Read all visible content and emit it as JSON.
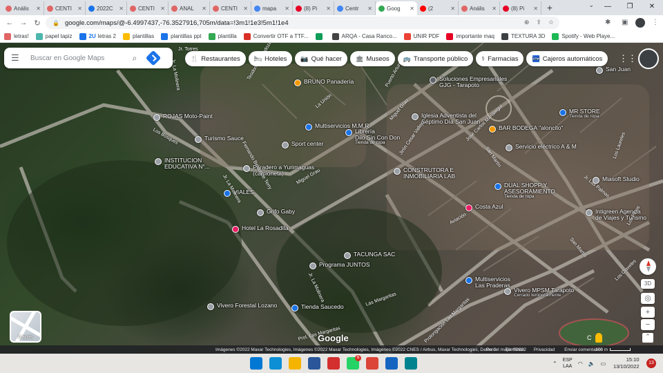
{
  "browser": {
    "tabs": [
      {
        "label": "Anális",
        "color": "#e06666"
      },
      {
        "label": "CENTI",
        "color": "#e06666"
      },
      {
        "label": "2022C",
        "color": "#1a73e8"
      },
      {
        "label": "CENTI",
        "color": "#e06666"
      },
      {
        "label": "ANAL",
        "color": "#e06666"
      },
      {
        "label": "CENTI",
        "color": "#e06666"
      },
      {
        "label": "mapa",
        "color": "#4285f4"
      },
      {
        "label": "(8) Pi",
        "color": "#e60023"
      },
      {
        "label": "Centr",
        "color": "#4285f4"
      },
      {
        "label": "Goog",
        "color": "#34a853",
        "active": true
      },
      {
        "label": "(2",
        "color": "#ff0000"
      },
      {
        "label": "Anális",
        "color": "#e06666"
      },
      {
        "label": "(8) Pi",
        "color": "#e60023"
      }
    ],
    "new_tab": "+",
    "url": "google.com/maps/@-6.4997437,-76.3527916,705m/data=!3m1!1e3!5m1!1e4"
  },
  "bookmarks": [
    {
      "label": "letras!",
      "color": "#e06666"
    },
    {
      "label": "papel tapiz",
      "color": "#4db6ac"
    },
    {
      "label": "letras 2",
      "color": "#1a73e8",
      "prefix": "2U"
    },
    {
      "label": "plantillas",
      "color": "#fbbc04"
    },
    {
      "label": "plantillas ppt",
      "color": "#1a73e8"
    },
    {
      "label": "plantilla",
      "color": "#34a853"
    },
    {
      "label": "Convertir OTF a TTF...",
      "color": "#d93025"
    },
    {
      "label": "",
      "color": "#0f9d58"
    },
    {
      "label": "ARQA - Casa Ranco...",
      "color": "#444444"
    },
    {
      "label": "UNIR PDF",
      "color": "#ea4335"
    },
    {
      "label": "importante maq",
      "color": "#e60023"
    },
    {
      "label": "TEXTURA 3D",
      "color": "#3c4043"
    },
    {
      "label": "Spotify - Web Playe...",
      "color": "#1db954"
    }
  ],
  "maps": {
    "search_placeholder": "Buscar en Google Maps",
    "chips": [
      {
        "label": "Restaurantes",
        "icon": "fork-knife-icon",
        "glyph": "🍴"
      },
      {
        "label": "Hoteles",
        "icon": "bed-icon",
        "glyph": "🛏"
      },
      {
        "label": "Qué hacer",
        "icon": "camera-icon",
        "glyph": "📷"
      },
      {
        "label": "Museos",
        "icon": "museum-icon",
        "glyph": "🏛"
      },
      {
        "label": "Transporte público",
        "icon": "bus-icon",
        "glyph": "🚌"
      },
      {
        "label": "Farmacias",
        "icon": "pharmacy-icon",
        "glyph": "⚕"
      },
      {
        "label": "Cajeros automáticos",
        "icon": "atm-icon",
        "glyph": "🏧"
      }
    ],
    "places": [
      {
        "name": "BRUNO Panadería",
        "sub": "",
        "color": "#f29900"
      },
      {
        "name": "Soluciones Empresariales",
        "sub": "",
        "line2": "GJG - Tarapoto",
        "color": "#5f6368"
      },
      {
        "name": "San Juan",
        "sub": "",
        "color": "#9aa0a6"
      },
      {
        "name": "MR STORE",
        "sub": "Tienda de ropa",
        "color": "#1a73e8"
      },
      {
        "name": "BAR BODEGA \"aloncito\"",
        "sub": "",
        "color": "#f29900"
      },
      {
        "name": "Iglesia Adventista del",
        "sub": "",
        "line2": "Séptimo Día San Juan",
        "color": "#9aa0a6"
      },
      {
        "name": "ROJAS Moto-Paint",
        "sub": "",
        "color": "#9aa0a6"
      },
      {
        "name": "Multiservicios M.M.R",
        "sub": "",
        "color": "#1a73e8"
      },
      {
        "name": "Librería",
        "sub": "",
        "line2": "Dilo Sin Con Don",
        "line3": "Tienda de ropa",
        "color": "#1a73e8"
      },
      {
        "name": "Servicio eléctrico A & M",
        "sub": "",
        "color": "#9aa0a6"
      },
      {
        "name": "Turismo Sauce",
        "sub": "",
        "color": "#9aa0a6"
      },
      {
        "name": "Sport center",
        "sub": "",
        "color": "#9aa0a6"
      },
      {
        "name": "INSTITUCION",
        "sub": "",
        "line2": "EDUCATIVA N°...",
        "color": "#9aa0a6"
      },
      {
        "name": "Paradero a Yurimaguas",
        "sub": "",
        "line2": "(camioneta)",
        "color": "#9aa0a6"
      },
      {
        "name": "CONSTRUTORA E",
        "sub": "",
        "line2": "INMOBILIARIA LAB",
        "color": "#9aa0a6"
      },
      {
        "name": "Miasoft Studio",
        "sub": "",
        "color": "#9aa0a6"
      },
      {
        "name": "DUAL SHOPP Y",
        "sub": "",
        "line2": "ASESORAMIENTO",
        "line3": "Tienda de ropa",
        "color": "#1a73e8"
      },
      {
        "name": "VIALES",
        "sub": "",
        "color": "#1a73e8"
      },
      {
        "name": "Grifo Gaby",
        "sub": "",
        "color": "#9aa0a6"
      },
      {
        "name": "Costa Azul",
        "sub": "",
        "color": "#e91e63"
      },
      {
        "name": "Intigreen Agencia",
        "sub": "",
        "line2": "de Viajes y Turismo",
        "color": "#9aa0a6"
      },
      {
        "name": "Hotel La Rosadita",
        "sub": "",
        "color": "#e91e63"
      },
      {
        "name": "TACUNGA SAC",
        "sub": "",
        "color": "#9aa0a6"
      },
      {
        "name": "Programa JUNTOS",
        "sub": "",
        "color": "#9aa0a6"
      },
      {
        "name": "Multiservicios",
        "sub": "",
        "line2": "Las Praderas",
        "color": "#1a73e8"
      },
      {
        "name": "Vivero MPSM Tarapoto",
        "sub": "Cerrado temporalmente",
        "color": "#9aa0a6"
      },
      {
        "name": "Vivero Forestal Lozano",
        "sub": "",
        "color": "#9aa0a6"
      },
      {
        "name": "Tienda Saucedo",
        "sub": "",
        "color": "#1a73e8"
      }
    ],
    "streets": [
      "Jr. Torres",
      "Jr. La Molinera",
      "Teodomiro Mendoza",
      "La Unión",
      "Puerto Arturo",
      "Miguel Grau",
      "Jirón Cesar Vallejo",
      "José Carlos Mariátegui",
      "San Martín",
      "Los Laureles",
      "Los Bosques",
      "Jr. La Molinera",
      "Fernando Belaunde Terry",
      "Miguel Grau",
      "Aviación",
      "Jr. La Molinera",
      "Las Margaritas",
      "Prol. Las Margaritas",
      "Prolongación Las Margaritas",
      "Los Claveles",
      "Los Pinos",
      "Jr. Las Palmas",
      "San Martín"
    ],
    "layers_label": "Capas",
    "logo": "Google",
    "compass_mark": "",
    "attribution": "Imágenes ©2022 Maxar Technologies, Imágenes ©2022 Maxar Technologies, Imágenes ©2022 CNES / Airbus, Maxar Technologies, Datos del mapa ©2022",
    "links": [
      "Perú",
      "Términos",
      "Privacidad",
      "Enviar comentarios"
    ],
    "scale": "100 m",
    "c_letter": "C"
  },
  "taskbar": {
    "icons": [
      {
        "name": "windows-start-icon",
        "color": "#0078d4"
      },
      {
        "name": "edge-icon",
        "color": "#0c8fd5"
      },
      {
        "name": "file-explorer-icon",
        "color": "#f4b400"
      },
      {
        "name": "store-icon",
        "color": "#2b579a"
      },
      {
        "name": "acrobat-icon",
        "color": "#d32f2f"
      },
      {
        "name": "whatsapp-icon",
        "color": "#25d366"
      },
      {
        "name": "chrome-icon",
        "color": "#db4437"
      },
      {
        "name": "app-icon-1",
        "color": "#1565c0"
      },
      {
        "name": "app-icon-2",
        "color": "#00838f"
      }
    ],
    "whatsapp_badge": "6",
    "lang_line1": "ESP",
    "lang_line2": "LAA",
    "time": "15:10",
    "date": "13/10/2022",
    "notifications": "13"
  }
}
